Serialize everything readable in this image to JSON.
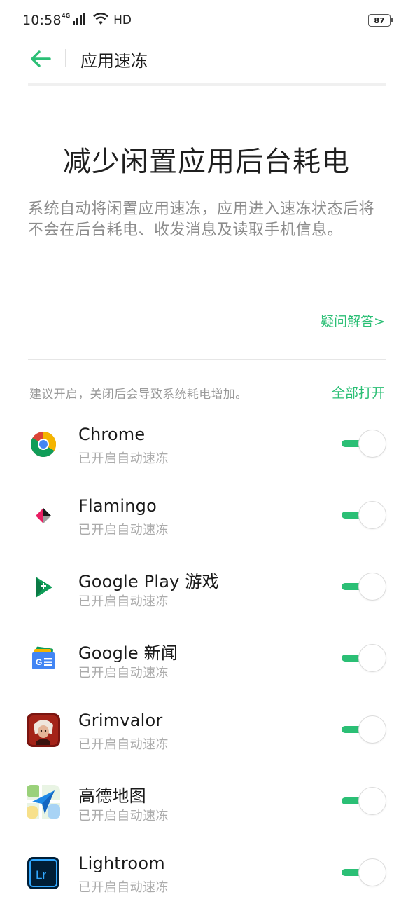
{
  "status_bar": {
    "time": "10:58",
    "network": "4G",
    "hd": "HD",
    "battery": "87"
  },
  "header": {
    "title": "应用速冻",
    "back_icon": "arrow-left-icon",
    "accent_color": "#2bbf75"
  },
  "hero": {
    "title": "减少闲置应用后台耗电",
    "description": "系统自动将闲置应用速冻，应用进入速冻状态后将不会在后台耗电、收发消息及读取手机信息。"
  },
  "faq_link": "疑问解答>",
  "list_header": {
    "hint": "建议开启，关闭后会导致系统耗电增加。",
    "open_all": "全部打开"
  },
  "apps": [
    {
      "name": "Chrome",
      "status": "已开启自动速冻",
      "icon": "chrome-icon",
      "enabled": true
    },
    {
      "name": "Flamingo",
      "status": "已开启自动速冻",
      "icon": "flamingo-icon",
      "enabled": true
    },
    {
      "name": "Google Play 游戏",
      "status": "已开启自动速冻",
      "icon": "google-play-games-icon",
      "enabled": true
    },
    {
      "name": "Google 新闻",
      "status": "已开启自动速冻",
      "icon": "google-news-icon",
      "enabled": true
    },
    {
      "name": "Grimvalor",
      "status": "已开启自动速冻",
      "icon": "grimvalor-icon",
      "enabled": true
    },
    {
      "name": "高德地图",
      "status": "已开启自动速冻",
      "icon": "amap-icon",
      "enabled": true
    },
    {
      "name": "Lightroom",
      "status": "已开启自动速冻",
      "icon": "lightroom-icon",
      "enabled": true
    }
  ]
}
